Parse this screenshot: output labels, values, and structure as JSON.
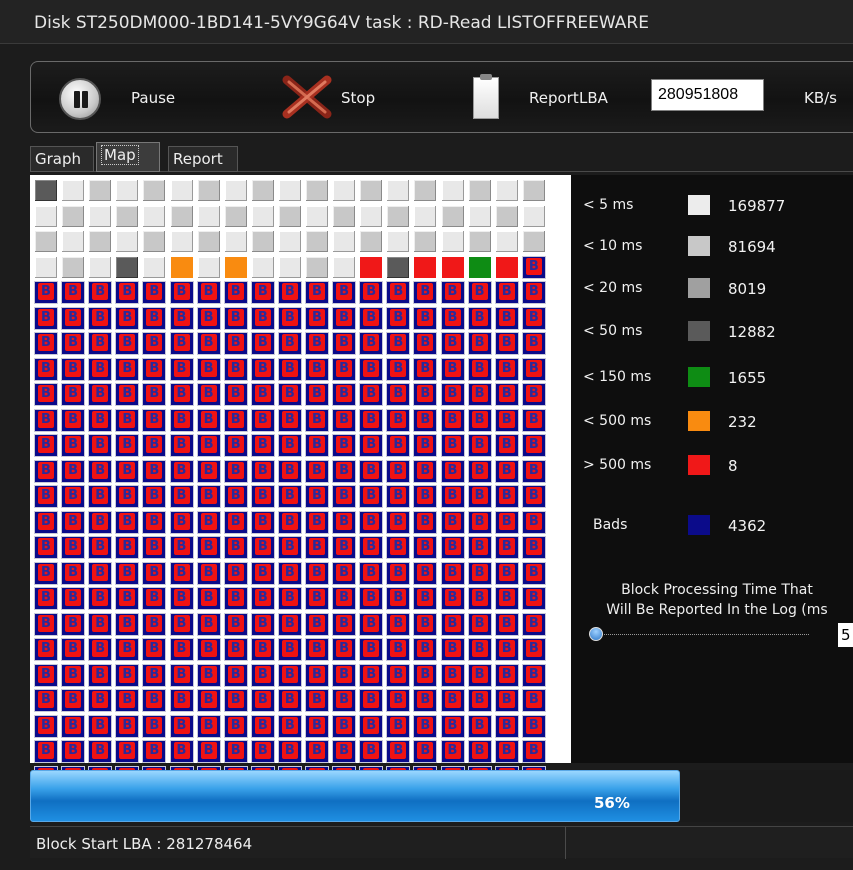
{
  "window": {
    "title": "Disk ST250DM000-1BD141-5VY9G64V   task : RD-Read  LISTOFFREEWARE"
  },
  "toolbar": {
    "pause_label": "Pause",
    "stop_label": "Stop",
    "report_label": "Report",
    "lba_label": "LBA",
    "lba_value": "280951808",
    "kbs_label": "KB/s"
  },
  "tabs": [
    {
      "label": "Graph",
      "active": false
    },
    {
      "label": "Map",
      "active": true
    },
    {
      "label": "Report",
      "active": false
    }
  ],
  "map": {
    "columns": 19,
    "cells": [
      "dg",
      "white",
      "lg",
      "white",
      "lg",
      "white",
      "lg",
      "white",
      "lg",
      "white",
      "lg",
      "white",
      "lg",
      "white",
      "lg",
      "white",
      "lg",
      "white",
      "lg",
      "white",
      "lg",
      "white",
      "lg",
      "white",
      "lg",
      "white",
      "lg",
      "white",
      "lg",
      "white",
      "lg",
      "white",
      "lg",
      "white",
      "lg",
      "white",
      "lg",
      "white",
      "lg",
      "white",
      "lg",
      "white",
      "lg",
      "white",
      "lg",
      "white",
      "lg",
      "white",
      "lg",
      "white",
      "lg",
      "white",
      "lg",
      "white",
      "lg",
      "white",
      "lg",
      "white",
      "lg",
      "white",
      "dg",
      "white",
      "orange",
      "white",
      "orange",
      "white",
      "white",
      "lg",
      "white",
      "red",
      "dg",
      "red",
      "red",
      "green",
      "red",
      "b",
      "b",
      "b",
      "b",
      "b",
      "b",
      "b",
      "b",
      "b",
      "b",
      "b",
      "b",
      "b",
      "b",
      "b",
      "b",
      "b",
      "b",
      "b",
      "b",
      "b",
      "b",
      "b",
      "b",
      "b",
      "b",
      "b",
      "b",
      "b",
      "b",
      "b",
      "b",
      "b",
      "b",
      "b",
      "b",
      "b",
      "b",
      "b",
      "b",
      "b",
      "b",
      "b",
      "b",
      "b",
      "b",
      "b",
      "b",
      "b",
      "b",
      "b",
      "b",
      "b",
      "b",
      "b",
      "b",
      "b",
      "b",
      "b",
      "b",
      "b",
      "b",
      "b",
      "b",
      "b",
      "b",
      "b",
      "b",
      "b",
      "b",
      "b",
      "b",
      "b",
      "b",
      "b",
      "b",
      "b",
      "b",
      "b",
      "b",
      "b",
      "b",
      "b",
      "b",
      "b",
      "b",
      "b",
      "b",
      "b",
      "b",
      "b",
      "b",
      "b",
      "b",
      "b",
      "b",
      "b",
      "b",
      "b",
      "b",
      "b",
      "b",
      "b",
      "b",
      "b",
      "b",
      "b",
      "b",
      "b",
      "b",
      "b",
      "b",
      "b",
      "b",
      "b",
      "b",
      "b",
      "b",
      "b",
      "b",
      "b",
      "b",
      "b",
      "b",
      "b",
      "b",
      "b",
      "b",
      "b",
      "b",
      "b",
      "b",
      "b",
      "b",
      "b",
      "b",
      "b",
      "b",
      "b",
      "b",
      "b",
      "b",
      "b",
      "b",
      "b",
      "b",
      "b",
      "b",
      "b",
      "b",
      "b",
      "b",
      "b",
      "b",
      "b",
      "b",
      "b",
      "b",
      "b",
      "b",
      "b",
      "b",
      "b",
      "b",
      "b",
      "b",
      "b",
      "b",
      "b",
      "b",
      "b",
      "b",
      "b",
      "b",
      "b",
      "b",
      "b",
      "b",
      "b",
      "b",
      "b",
      "b",
      "b",
      "b",
      "b",
      "b",
      "b",
      "b",
      "b",
      "b",
      "b",
      "b",
      "b",
      "b",
      "b",
      "b",
      "b",
      "b",
      "b",
      "b",
      "b",
      "b",
      "b",
      "b",
      "b",
      "b",
      "b",
      "b",
      "b",
      "b",
      "b",
      "b",
      "b",
      "b",
      "b",
      "b",
      "b",
      "b",
      "b",
      "b",
      "b",
      "b",
      "b",
      "b",
      "b",
      "b",
      "b",
      "b",
      "b",
      "b",
      "b",
      "b",
      "b",
      "b",
      "b",
      "b",
      "b",
      "b",
      "b",
      "b",
      "b",
      "b",
      "b",
      "b",
      "b",
      "b",
      "b",
      "b",
      "b",
      "b",
      "b",
      "b",
      "b",
      "b",
      "b",
      "b",
      "b",
      "b",
      "b",
      "b",
      "b",
      "b",
      "b",
      "b",
      "b",
      "b",
      "b",
      "b",
      "b",
      "b",
      "b",
      "b",
      "b",
      "b",
      "b",
      "b",
      "b",
      "b",
      "b",
      "b",
      "b",
      "b",
      "b",
      "b",
      "b",
      "b",
      "b",
      "b",
      "b",
      "b",
      "b",
      "b",
      "b",
      "b",
      "b",
      "b",
      "b",
      "b",
      "b",
      "b",
      "b",
      "b",
      "b",
      "b",
      "b",
      "b",
      "b",
      "b",
      "b",
      "b",
      "b",
      "b",
      "b",
      "b",
      "b",
      "b",
      "b",
      "b",
      "b",
      "b",
      "b",
      "b",
      "b",
      "b",
      "b",
      "b",
      "b",
      "b",
      "b",
      "b",
      "b",
      "b",
      "b",
      "b",
      "b",
      "b",
      "b",
      "b",
      "b",
      "b",
      "b",
      "b",
      "b",
      "b",
      "b",
      "b",
      "b",
      "b",
      "b",
      "b",
      "b",
      "b",
      "b",
      "b",
      "b",
      "b",
      "b",
      "b",
      "b",
      "b",
      "b",
      "b",
      "b",
      "b",
      "b",
      "b",
      "b",
      "b",
      "b",
      "b",
      "b",
      "b",
      "b",
      "b",
      "b",
      "b",
      "b",
      "b",
      "b",
      "b",
      "b",
      "b",
      "b",
      "b",
      "b",
      "b",
      "b",
      "b",
      "b",
      "b",
      "b",
      "b",
      "b",
      "b",
      "b",
      "b",
      "b",
      "b"
    ]
  },
  "legend": [
    {
      "label": "< 5 ms",
      "color": "#ececec",
      "count": "169877"
    },
    {
      "label": "< 10 ms",
      "color": "#c8c8c8",
      "count": "81694"
    },
    {
      "label": "< 20 ms",
      "color": "#a0a0a0",
      "count": "8019"
    },
    {
      "label": "< 50 ms",
      "color": "#5a5a5a",
      "count": "12882"
    },
    {
      "label": "< 150 ms",
      "color": "#0e8c14",
      "count": "1655"
    },
    {
      "label": "< 500 ms",
      "color": "#f98b10",
      "count": "232"
    },
    {
      "label": "> 500 ms",
      "color": "#f01818",
      "count": "8"
    },
    {
      "label": "Bads",
      "color": "#0b0b8a",
      "count": "4362"
    }
  ],
  "block_processing": {
    "caption_line1": "Block Processing Time That",
    "caption_line2": "Will Be Reported In the Log (ms",
    "slider_value": "5"
  },
  "progress": {
    "percent": 0.56,
    "label": "56%"
  },
  "status": {
    "block_start": "Block Start LBA : 281278464"
  }
}
